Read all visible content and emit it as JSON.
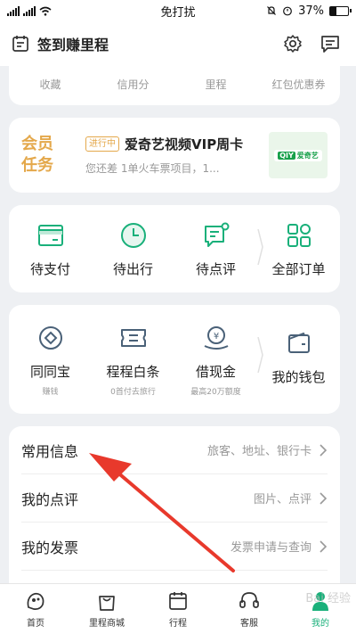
{
  "status_bar": {
    "center_text": "免打扰",
    "battery_text": "37%",
    "battery_level": 0.37
  },
  "header": {
    "title": "签到赚里程"
  },
  "stats": [
    {
      "label": "收藏"
    },
    {
      "label": "信用分"
    },
    {
      "label": "里程"
    },
    {
      "label": "红包优惠券"
    }
  ],
  "member": {
    "title_line1": "会员",
    "title_line2": "任务",
    "tag": "进行中",
    "task_title": "爱奇艺视频VIP周卡",
    "task_desc": "您还差 1单火车票项目，1...",
    "thumb_logo": "爱奇艺",
    "thumb_logo_box": "QIY"
  },
  "orders": [
    {
      "label": "待支付",
      "icon": "card-icon"
    },
    {
      "label": "待出行",
      "icon": "clock-icon"
    },
    {
      "label": "待点评",
      "icon": "comment-icon"
    },
    {
      "label": "全部订单",
      "icon": "grid-icon"
    }
  ],
  "wallet": [
    {
      "label": "同同宝",
      "sub": "赚钱",
      "icon": "diamond-coin-icon"
    },
    {
      "label": "程程白条",
      "sub": "0首付去旅行",
      "icon": "ticket-icon"
    },
    {
      "label": "借现金",
      "sub": "最高20万额度",
      "icon": "cash-icon"
    },
    {
      "label": "我的钱包",
      "sub": "",
      "icon": "wallet-icon"
    }
  ],
  "list": [
    {
      "label": "常用信息",
      "hint": "旅客、地址、银行卡"
    },
    {
      "label": "我的点评",
      "hint": "图片、点评"
    },
    {
      "label": "我的发票",
      "hint": "发票申请与查询"
    }
  ],
  "tabs": [
    {
      "label": "首页",
      "icon": "home-icon"
    },
    {
      "label": "里程商城",
      "icon": "shopping-bag-icon"
    },
    {
      "label": "行程",
      "icon": "calendar-icon"
    },
    {
      "label": "客服",
      "icon": "headset-icon"
    },
    {
      "label": "我的",
      "icon": "profile-icon",
      "active": true
    }
  ],
  "colors": {
    "accent": "#19b07a",
    "gold": "#e4a84b",
    "arrow": "#e8392c"
  },
  "watermark": "Bai 经验"
}
